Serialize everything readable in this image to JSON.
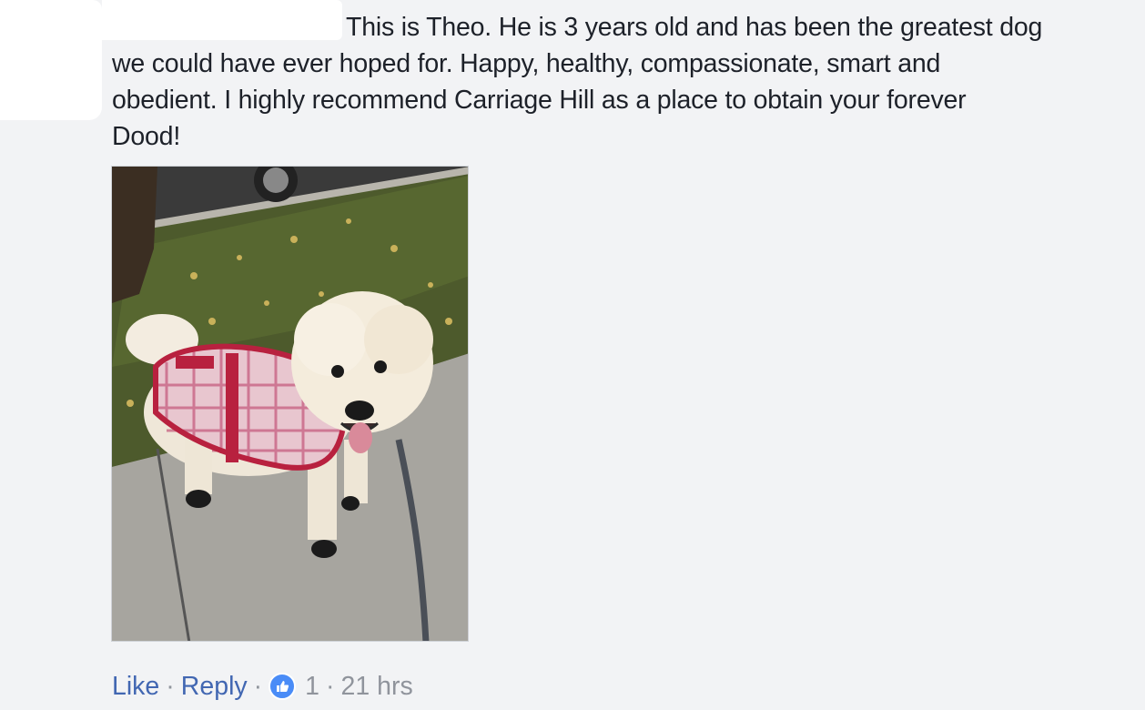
{
  "comment": {
    "text_lines": [
      "This is Theo. He is 3 years old and has been the greatest dog",
      "we could have ever hoped for. Happy, healthy, compassionate, smart and",
      "obedient. I highly recommend Carriage Hill as a place to obtain your forever",
      "Dood!"
    ],
    "photo": {
      "subject": "white doodle dog in plaid coat on sidewalk",
      "icon": "dog-photo"
    }
  },
  "actions": {
    "like_label": "Like",
    "separator": "·",
    "reply_label": "Reply",
    "reaction_icon": "thumbs-up-icon",
    "reaction_count": "1",
    "timestamp": "21 hrs"
  },
  "colors": {
    "background": "#f2f3f5",
    "text": "#1d2129",
    "link": "#4267b2",
    "meta": "#90949c",
    "like_badge": "#4a8cf7"
  }
}
